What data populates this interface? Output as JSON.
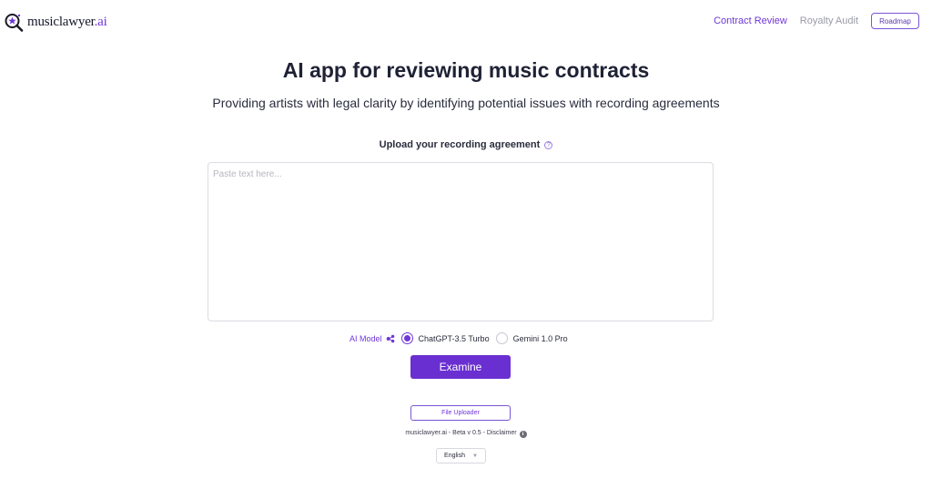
{
  "header": {
    "brand_main": "musiclawyer",
    "brand_suffix": ".ai",
    "nav": {
      "contract_review": "Contract Review",
      "royalty_audit": "Royalty Audit",
      "roadmap": "Roadmap"
    }
  },
  "hero": {
    "title": "AI app for reviewing music contracts",
    "subtitle": "Providing artists with legal clarity by identifying potential issues with recording agreements"
  },
  "upload": {
    "label": "Upload your recording agreement",
    "help_icon": "?",
    "placeholder": "Paste text here...",
    "value": ""
  },
  "model": {
    "label": "AI Model",
    "options": [
      {
        "label": "ChatGPT-3.5 Turbo",
        "selected": true
      },
      {
        "label": "Gemini 1.0 Pro",
        "selected": false
      }
    ]
  },
  "actions": {
    "examine": "Examine",
    "file_uploader": "File Uploader"
  },
  "footer": {
    "text": "musiclawyer.ai - Beta v 0.5 - Disclaimer",
    "info_icon": "i"
  },
  "language": {
    "selected": "English"
  },
  "colors": {
    "accent": "#6f37d8",
    "button": "#6a2fd0",
    "text": "#1f2235"
  }
}
